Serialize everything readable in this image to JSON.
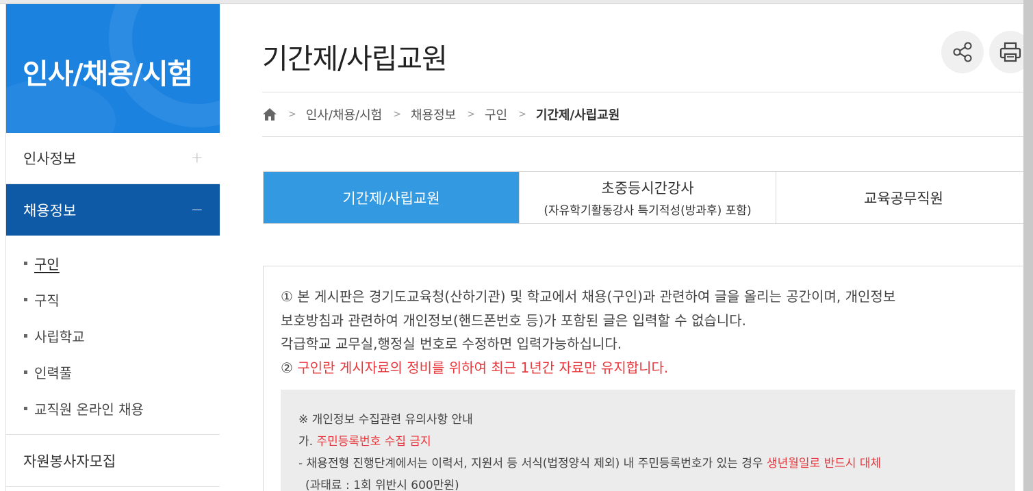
{
  "sidebar": {
    "title": "인사/채용/시험",
    "menu": [
      {
        "label": "인사정보",
        "toggle": "+"
      },
      {
        "label": "채용정보",
        "toggle": "−"
      },
      {
        "label": "자원봉사자모집"
      }
    ],
    "sub_items": [
      {
        "label": "구인"
      },
      {
        "label": "구직"
      },
      {
        "label": "사립학교"
      },
      {
        "label": "인력풀"
      },
      {
        "label": "교직원 온라인 채용"
      }
    ]
  },
  "page": {
    "title": "기간제/사립교원",
    "share_icon": "share-icon",
    "print_icon": "print-icon"
  },
  "breadcrumb": {
    "home_icon": "home-icon",
    "items": [
      "인사/채용/시험",
      "채용정보",
      "구인",
      "기간제/사립교원"
    ]
  },
  "tabs": [
    {
      "label": "기간제/사립교원",
      "sub": ""
    },
    {
      "label": "초중등시간강사",
      "sub": "(자유학기활동강사 특기적성(방과후) 포함)"
    },
    {
      "label": "교육공무직원",
      "sub": ""
    }
  ],
  "notice": {
    "line1": "① 본 게시판은 경기도교육청(산하기관) 및 학교에서 채용(구인)과 관련하여 글을 올리는 공간이며, 개인정보",
    "line2": "보호방침과 관련하여 개인정보(핸드폰번호 등)가 포함된 글은 입력할 수 없습니다.",
    "line3": "각급학교 교무실,행정실 번호로 수정하면 입력가능하십니다.",
    "line4_prefix": "② ",
    "line4_red": "구인란 게시자료의 정비를 위하여 최근 1년간 자료만 유지합니다."
  },
  "info": {
    "heading": "※ 개인정보 수집관련 유의사항 안내",
    "item_a_prefix": "가. ",
    "item_a_red": "주민등록번호 수집 금지",
    "detail_prefix": "- 채용전형 진행단계에서는 이력서, 지원서 등 서식(법정양식 제외) 내 주민등록번호가 있는 경우 ",
    "detail_red": "생년월일로 반드시 대체",
    "detail_next": "(과태료 : 1회 위반시 600만원)"
  },
  "colors": {
    "sidebar_header": "#1b82e0",
    "sidebar_active": "#0e5aa7",
    "tab_active": "#3399e0",
    "warning_red": "#e8383d"
  }
}
